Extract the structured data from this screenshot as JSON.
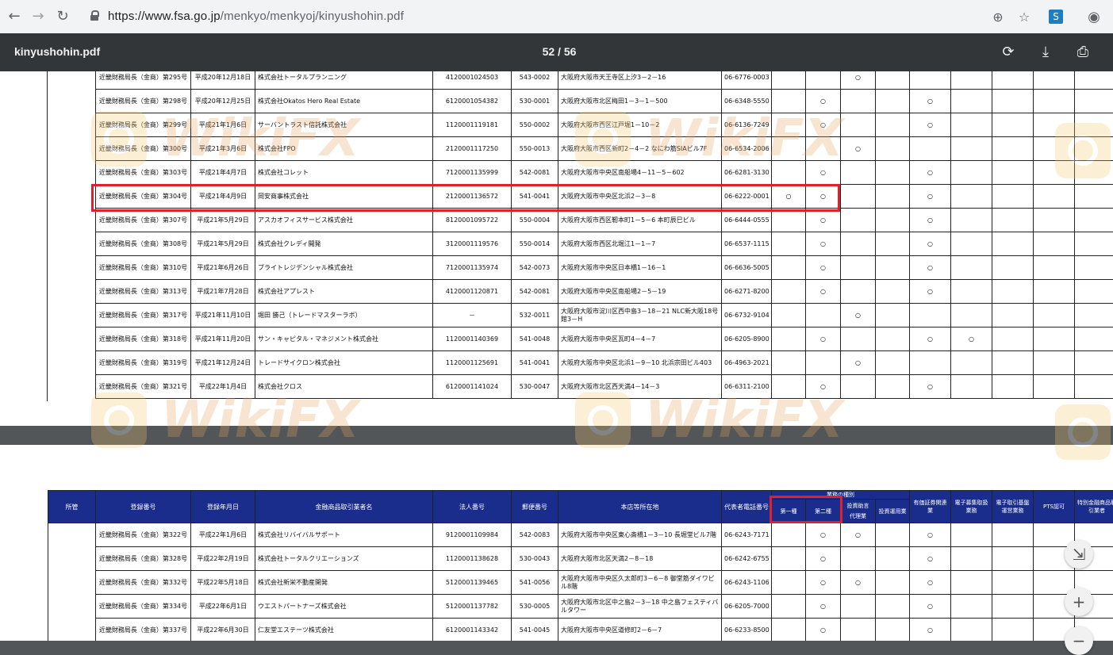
{
  "browser": {
    "url_host": "https://www.fsa.go.jp",
    "url_path": "/menkyo/menkyoj/kinyushohin.pdf",
    "back_icon": "arrow-left-icon",
    "forward_icon": "arrow-right-icon",
    "reload_icon": "reload-icon"
  },
  "viewer": {
    "title": "kinyushohin.pdf",
    "page_indicator": "52 / 56"
  },
  "watermark": "WikiFX",
  "colors": {
    "highlight": "#e0202a",
    "header_blue": "#1a2c8c",
    "toolbar": "#323639"
  },
  "page1_rows": [
    {
      "reg": "近畿財務局長（金商）第295号",
      "date": "平成20年12月18日",
      "name": "株式会社トータルプランニング",
      "corp": "4120001024503",
      "zip": "543-0002",
      "addr": "大阪府大阪市天王寺区上汐3－2－16",
      "tel": "06-6776-0003",
      "c1": "",
      "c2": "",
      "c3": "○",
      "c4": "",
      "c5": "",
      "c6": ""
    },
    {
      "reg": "近畿財務局長（金商）第298号",
      "date": "平成20年12月25日",
      "name": "株式会社Okatos Hero Real Estate",
      "corp": "6120001054382",
      "zip": "530-0001",
      "addr": "大阪府大阪市北区梅田1－3－1－500",
      "tel": "06-6348-5550",
      "c1": "",
      "c2": "○",
      "c3": "",
      "c4": "",
      "c5": "○",
      "c6": ""
    },
    {
      "reg": "近畿財務局長（金商）第299号",
      "date": "平成21年1月6日",
      "name": "サーバントラスト信託株式会社",
      "corp": "1120001119181",
      "zip": "550-0002",
      "addr": "大阪府大阪市西区江戸堀1－10－2",
      "tel": "06-6136-7249",
      "c1": "",
      "c2": "○",
      "c3": "",
      "c4": "",
      "c5": "○",
      "c6": ""
    },
    {
      "reg": "近畿財務局長（金商）第300号",
      "date": "平成21年3月6日",
      "name": "株式会社FPO",
      "corp": "2120001117250",
      "zip": "550-0013",
      "addr": "大阪府大阪市西区新町2－4－2 なにわ筋SIAビル7F",
      "tel": "06-6534-2006",
      "c1": "",
      "c2": "",
      "c3": "○",
      "c4": "",
      "c5": "",
      "c6": ""
    },
    {
      "reg": "近畿財務局長（金商）第303号",
      "date": "平成21年4月7日",
      "name": "株式会社コレット",
      "corp": "7120001135999",
      "zip": "542-0081",
      "addr": "大阪府大阪市中央区南船場4－11－5－602",
      "tel": "06-6281-3130",
      "c1": "",
      "c2": "○",
      "c3": "",
      "c4": "",
      "c5": "○",
      "c6": ""
    },
    {
      "reg": "近畿財務局長（金商）第304号",
      "date": "平成21年4月9日",
      "name": "岡安商事株式会社",
      "corp": "2120001136572",
      "zip": "541-0041",
      "addr": "大阪府大阪市中央区北浜2－3－8",
      "tel": "06-6222-0001",
      "c1": "○",
      "c2": "○",
      "c3": "",
      "c4": "",
      "c5": "○",
      "c6": ""
    },
    {
      "reg": "近畿財務局長（金商）第307号",
      "date": "平成21年5月29日",
      "name": "アスカオフィスサービス株式会社",
      "corp": "8120001095722",
      "zip": "550-0004",
      "addr": "大阪府大阪市西区靭本町1－5－6 本町辰巳ビル",
      "tel": "06-6444-0555",
      "c1": "",
      "c2": "○",
      "c3": "",
      "c4": "",
      "c5": "○",
      "c6": ""
    },
    {
      "reg": "近畿財務局長（金商）第308号",
      "date": "平成21年5月29日",
      "name": "株式会社クレディ開発",
      "corp": "3120001119576",
      "zip": "550-0014",
      "addr": "大阪府大阪市西区北堀江1－1－7",
      "tel": "06-6537-1115",
      "c1": "",
      "c2": "○",
      "c3": "",
      "c4": "",
      "c5": "○",
      "c6": ""
    },
    {
      "reg": "近畿財務局長（金商）第310号",
      "date": "平成21年6月26日",
      "name": "ブライトレジデンシャル株式会社",
      "corp": "7120001135974",
      "zip": "542-0073",
      "addr": "大阪府大阪市中央区日本橋1－16－1",
      "tel": "06-6636-5005",
      "c1": "",
      "c2": "○",
      "c3": "",
      "c4": "",
      "c5": "○",
      "c6": ""
    },
    {
      "reg": "近畿財務局長（金商）第313号",
      "date": "平成21年7月28日",
      "name": "株式会社アプレスト",
      "corp": "4120001120871",
      "zip": "542-0081",
      "addr": "大阪府大阪市中央区南船場2－5－19",
      "tel": "06-6271-8200",
      "c1": "",
      "c2": "○",
      "c3": "",
      "c4": "",
      "c5": "○",
      "c6": ""
    },
    {
      "reg": "近畿財務局長（金商）第317号",
      "date": "平成21年11月10日",
      "name": "堀田 勝己（トレードマスターラボ）",
      "corp": "－",
      "zip": "532-0011",
      "addr": "大阪府大阪市淀川区西中島3－18－21 NLC新大阪18号館3－H",
      "tel": "06-6732-9104",
      "c1": "",
      "c2": "",
      "c3": "○",
      "c4": "",
      "c5": "",
      "c6": ""
    },
    {
      "reg": "近畿財務局長（金商）第318号",
      "date": "平成21年11月20日",
      "name": "サン・キャピタル・マネジメント株式会社",
      "corp": "1120001140369",
      "zip": "541-0048",
      "addr": "大阪府大阪市中央区瓦町4－4－7",
      "tel": "06-6205-8900",
      "c1": "",
      "c2": "○",
      "c3": "",
      "c4": "",
      "c5": "○",
      "c6": "○"
    },
    {
      "reg": "近畿財務局長（金商）第319号",
      "date": "平成21年12月24日",
      "name": "トレードサイクロン株式会社",
      "corp": "1120001125691",
      "zip": "541-0041",
      "addr": "大阪府大阪市中央区北浜1－9－10 北浜宗田ビル403",
      "tel": "06-4963-2021",
      "c1": "",
      "c2": "",
      "c3": "○",
      "c4": "",
      "c5": "",
      "c6": ""
    },
    {
      "reg": "近畿財務局長（金商）第321号",
      "date": "平成22年1月4日",
      "name": "株式会社クロス",
      "corp": "6120001141024",
      "zip": "530-0047",
      "addr": "大阪府大阪市北区西天満4－14－3",
      "tel": "06-6311-2100",
      "c1": "",
      "c2": "○",
      "c3": "",
      "c4": "",
      "c5": "○",
      "c6": ""
    }
  ],
  "page2_header": {
    "col_jurisdiction": "所管",
    "col_reg": "登録番号",
    "col_date": "登録年月日",
    "col_name": "金融商品取引業者名",
    "col_corp": "法人番号",
    "col_zip": "郵便番号",
    "col_addr": "本店等所在地",
    "col_tel": "代表者電話番号",
    "col_kind": "業務の種別",
    "col_kind1": "第一種",
    "col_kind2": "第二種",
    "col_kind3a": "投資助言",
    "col_kind3b": "代理業",
    "col_kind4": "投資運用業",
    "col_sec": "有価証券関連業",
    "col_ecraise": "電子募集取扱業務",
    "col_ectrade": "電子取引基盤運営業務",
    "col_pts": "PTS認可",
    "col_special": "特別金融商品取引業者"
  },
  "page2_rows": [
    {
      "reg": "近畿財務局長（金商）第322号",
      "date": "平成22年1月6日",
      "name": "株式会社リバイバルサポート",
      "corp": "9120001109984",
      "zip": "542-0083",
      "addr": "大阪府大阪市中央区東心斎橋1－3－10 長堀堂ビル7階",
      "tel": "06-6243-7171",
      "c1": "",
      "c2": "○",
      "c3": "○",
      "c4": "",
      "c5": "○",
      "c6": ""
    },
    {
      "reg": "近畿財務局長（金商）第328号",
      "date": "平成22年2月19日",
      "name": "株式会社トータルクリエーションズ",
      "corp": "1120001138628",
      "zip": "530-0043",
      "addr": "大阪府大阪市北区天満2－8－18",
      "tel": "06-6242-6755",
      "c1": "",
      "c2": "○",
      "c3": "",
      "c4": "",
      "c5": "○",
      "c6": ""
    },
    {
      "reg": "近畿財務局長（金商）第332号",
      "date": "平成22年5月18日",
      "name": "株式会社新栄不動産開発",
      "corp": "5120001139465",
      "zip": "541-0056",
      "addr": "大阪府大阪市中央区久太郎町3－6－8 御堂筋ダイワビル8階",
      "tel": "06-6243-1106",
      "c1": "",
      "c2": "○",
      "c3": "○",
      "c4": "",
      "c5": "○",
      "c6": ""
    },
    {
      "reg": "近畿財務局長（金商）第334号",
      "date": "平成22年6月1日",
      "name": "ウエストパートナーズ株式会社",
      "corp": "5120001137782",
      "zip": "530-0005",
      "addr": "大阪府大阪市北区中之島2－3－18 中之島フェスティバルタワー",
      "tel": "06-6205-7000",
      "c1": "",
      "c2": "○",
      "c3": "",
      "c4": "",
      "c5": "○",
      "c6": ""
    },
    {
      "reg": "近畿財務局長（金商）第337号",
      "date": "平成22年6月30日",
      "name": "仁友堂エステーツ株式会社",
      "corp": "6120001143342",
      "zip": "541-0045",
      "addr": "大阪府大阪市中央区道修町2－6－7",
      "tel": "06-6233-8500",
      "c1": "",
      "c2": "○",
      "c3": "",
      "c4": "",
      "c5": "○",
      "c6": ""
    }
  ]
}
